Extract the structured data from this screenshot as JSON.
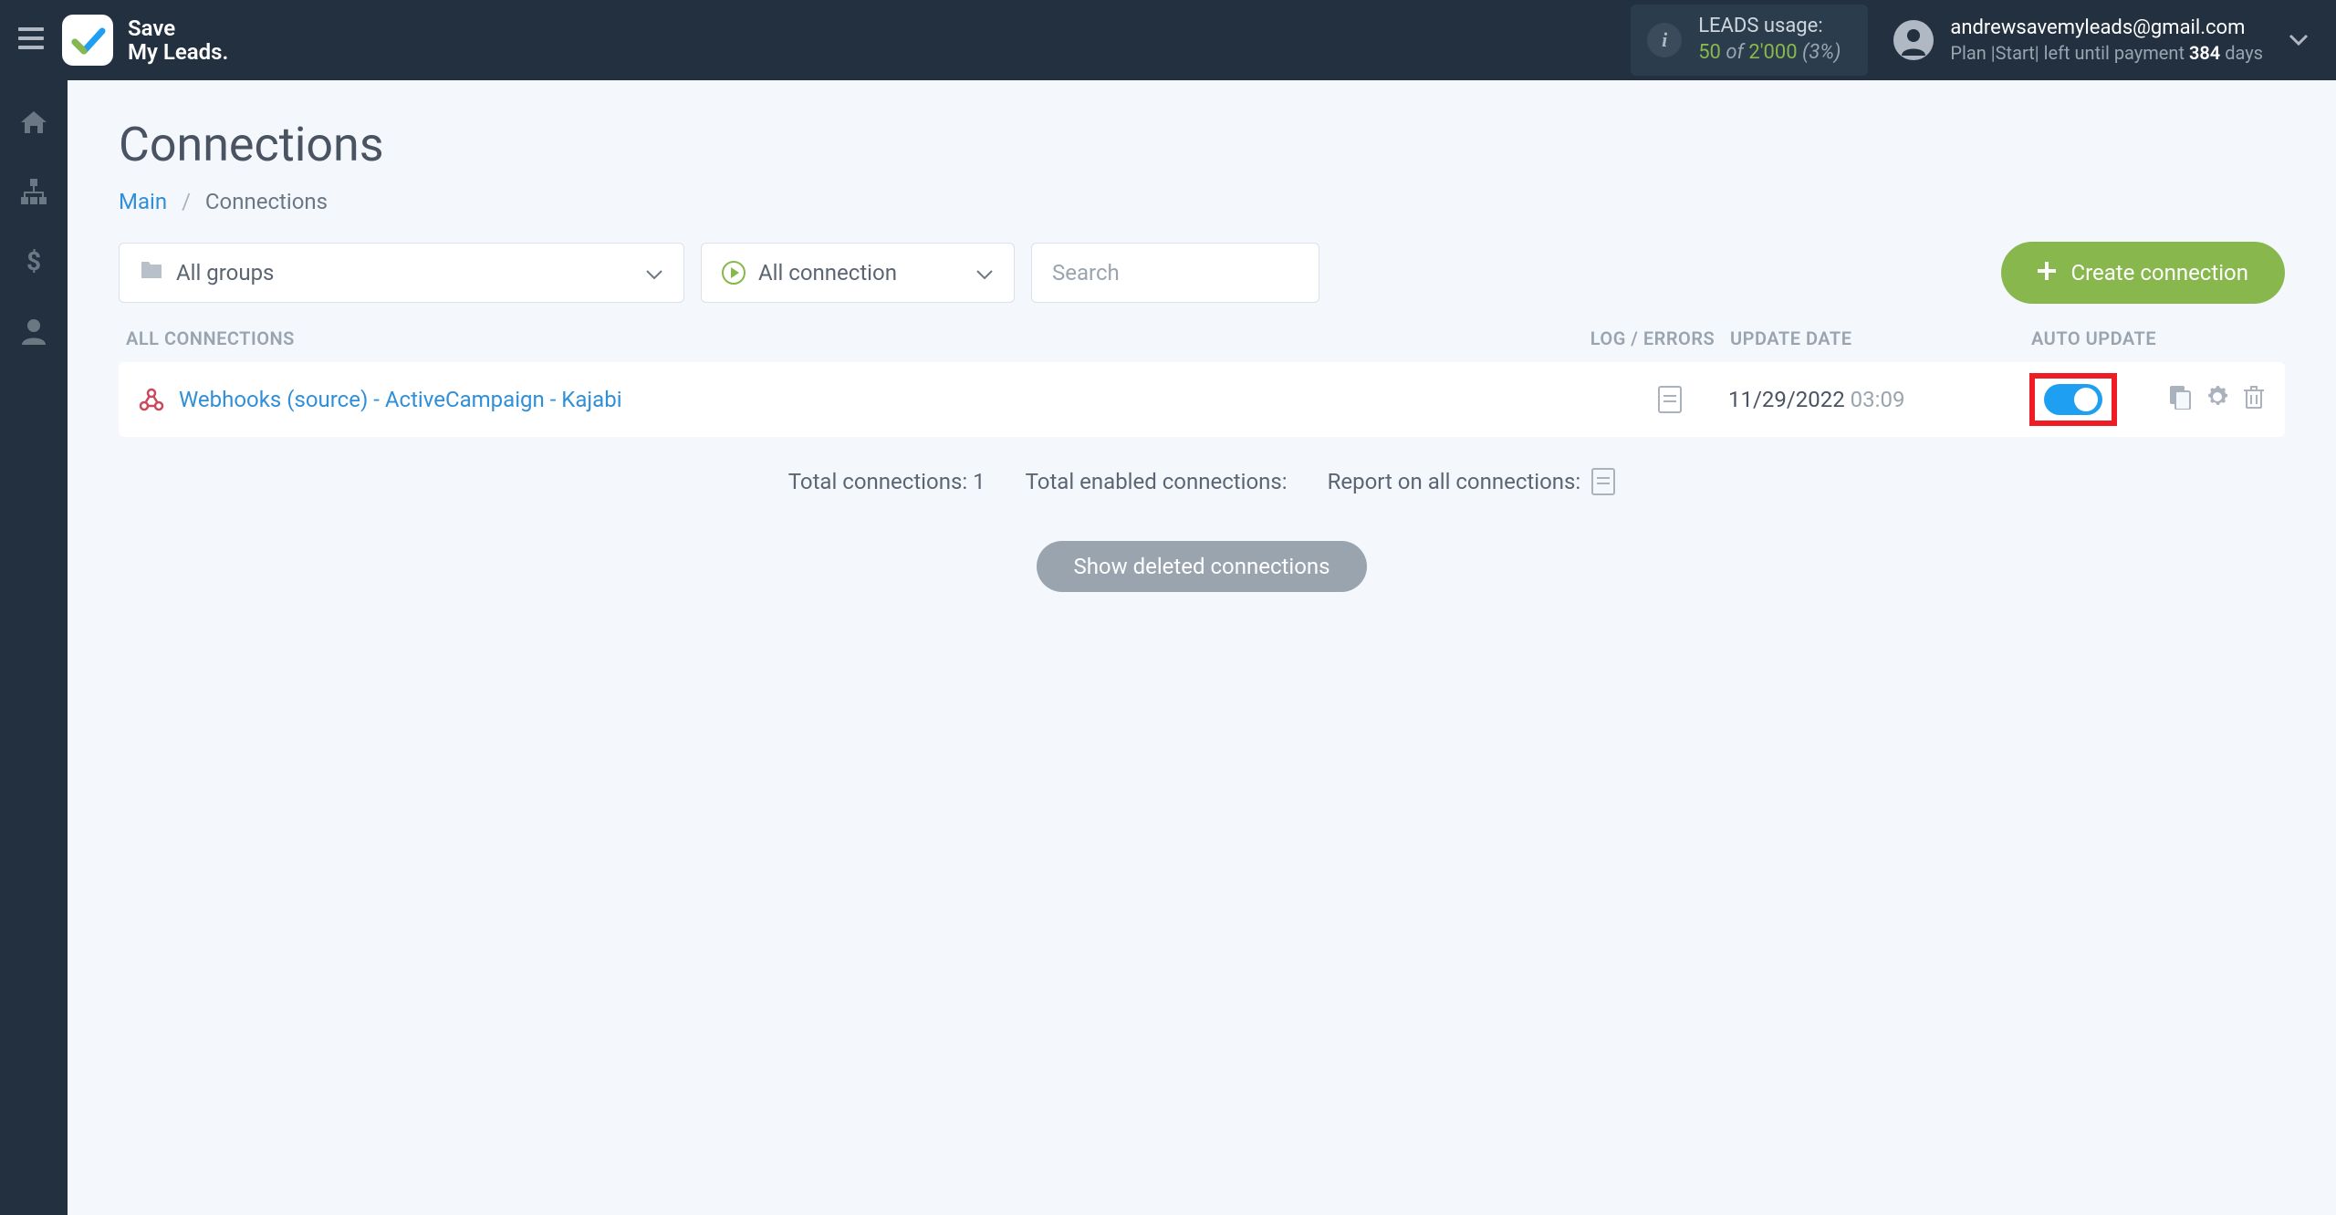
{
  "header": {
    "logo_line1": "Save",
    "logo_line2": "My Leads.",
    "usage": {
      "label": "LEADS usage:",
      "used": "50",
      "of": " of ",
      "limit": "2'000",
      "pct": " (3%)"
    },
    "user": {
      "email": "andrewsavemyleads@gmail.com",
      "plan_prefix": "Plan |Start| left until payment ",
      "plan_days": "384",
      "plan_suffix": " days"
    }
  },
  "page": {
    "title": "Connections",
    "breadcrumb": {
      "main": "Main",
      "current": "Connections"
    }
  },
  "filters": {
    "groups_label": "All groups",
    "conn_label": "All connection",
    "search_placeholder": "Search",
    "create_label": "Create connection"
  },
  "table": {
    "headers": {
      "all": "ALL CONNECTIONS",
      "log": "LOG / ERRORS",
      "date": "UPDATE DATE",
      "auto": "AUTO UPDATE"
    },
    "rows": [
      {
        "name": "Webhooks (source) - ActiveCampaign - Kajabi",
        "date": "11/29/2022",
        "time": "03:09",
        "auto_update": true
      }
    ]
  },
  "summary": {
    "total_label": "Total connections: ",
    "total_value": "1",
    "enabled_label": "Total enabled connections:",
    "report_label": "Report on all connections:"
  },
  "deleted_btn": "Show deleted connections"
}
